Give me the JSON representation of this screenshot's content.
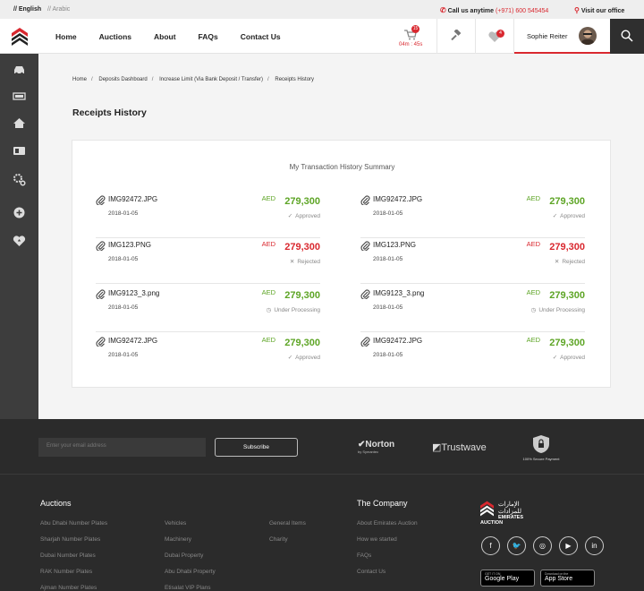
{
  "topbar": {
    "lang_english": "// English",
    "lang_arabic": "// Arabic",
    "call_label": "Call us anytime",
    "call_number": "(+971) 600 545454",
    "visit_label": "Visit our office"
  },
  "header": {
    "nav": [
      "Home",
      "Auctions",
      "About",
      "FAQs",
      "Contact Us"
    ],
    "cart_count": "15",
    "cart_timer": "04m : 45s",
    "fav_count": "4",
    "user_name": "Sophie Reiter"
  },
  "breadcrumb": [
    "Home",
    "Deposits Dashboard",
    "Increase Limit (Via Bank Deposit / Transfer)",
    "Receipts History"
  ],
  "page_title": "Receipts History",
  "summary_title": "My Transaction History Summary",
  "receipts_left": [
    {
      "file": "IMG92472.JPG",
      "date": "2018-01-05",
      "currency": "AED",
      "amount": "279,300",
      "status": "Approved",
      "state": "approved"
    },
    {
      "file": "IMG123.PNG",
      "date": "2018-01-05",
      "currency": "AED",
      "amount": "279,300",
      "status": "Rejected",
      "state": "rejected"
    },
    {
      "file": "IMG9123_3.png",
      "date": "2018-01-05",
      "currency": "AED",
      "amount": "279,300",
      "status": "Under Processing",
      "state": "processing"
    },
    {
      "file": "IMG92472.JPG",
      "date": "2018-01-05",
      "currency": "AED",
      "amount": "279,300",
      "status": "Approved",
      "state": "approved"
    }
  ],
  "receipts_right": [
    {
      "file": "IMG92472.JPG",
      "date": "2018-01-05",
      "currency": "AED",
      "amount": "279,300",
      "status": "Approved",
      "state": "approved"
    },
    {
      "file": "IMG123.PNG",
      "date": "2018-01-05",
      "currency": "AED",
      "amount": "279,300",
      "status": "Rejected",
      "state": "rejected"
    },
    {
      "file": "IMG9123_3.png",
      "date": "2018-01-05",
      "currency": "AED",
      "amount": "279,300",
      "status": "Under Processing",
      "state": "processing"
    },
    {
      "file": "IMG92472.JPG",
      "date": "2018-01-05",
      "currency": "AED",
      "amount": "279,300",
      "status": "Approved",
      "state": "approved"
    }
  ],
  "colors": {
    "approved": "#5ea526",
    "rejected": "#d9282f",
    "processing": "#5ea526",
    "accent": "#d9282f"
  },
  "footer": {
    "email_placeholder": "Enter your email address",
    "subscribe": "Subscribe",
    "norton": "Norton",
    "norton_sub": "by Symantec",
    "trustwave": "Trustwave",
    "secure": "100% Secure Payment",
    "auctions_title": "Auctions",
    "company_title": "The Company",
    "col1": [
      "Abu Dhabi Number Plates",
      "Sharjah Number Plates",
      "Dubai Number Plates",
      "RAK Number Plates",
      "Ajman Number Plates"
    ],
    "col2": [
      "Vehicles",
      "Machinery",
      "Dubai Property",
      "Abu Dhabi Property",
      "Etisalat VIP Plans"
    ],
    "col3": [
      "General Items",
      "Charity"
    ],
    "col4": [
      "About Emirates Auction",
      "How we started",
      "FAQs",
      "Contact Us"
    ],
    "brand_arabic": "الإمارات للمزادات",
    "brand": "EMIRATES AUCTION",
    "google_small": "GET IT ON",
    "google": "Google Play",
    "apple_small": "Download on the",
    "apple": "App Store"
  }
}
